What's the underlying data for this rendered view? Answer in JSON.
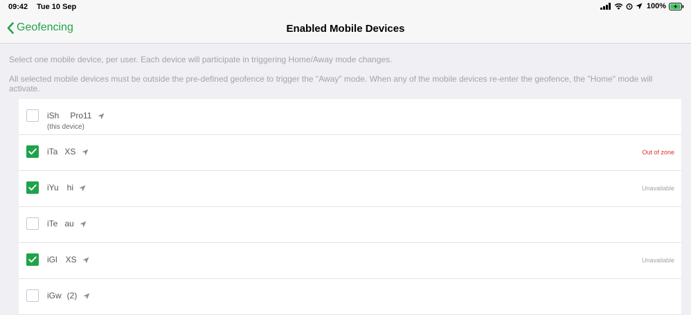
{
  "status_bar": {
    "time": "09:42",
    "date": "Tue 10 Sep",
    "battery": "100%"
  },
  "nav": {
    "back_label": "Geofencing",
    "title": "Enabled Mobile Devices"
  },
  "info": {
    "line1": "Select one mobile device, per user. Each device will participate in triggering Home/Away mode changes.",
    "line2": "All selected mobile devices must be outside the pre-defined geofence to trigger the \"Away\" mode. When any of the mobile devices re-enter the geofence, the \"Home\" mode will activate."
  },
  "devices": [
    {
      "name": "iSh        Pro11",
      "subtitle": "(this device)",
      "checked": false,
      "status": ""
    },
    {
      "name": "iTa     XS",
      "subtitle": "",
      "checked": true,
      "status": "Out of zone"
    },
    {
      "name": "iYu      hi",
      "subtitle": "",
      "checked": true,
      "status": "Unavailable"
    },
    {
      "name": "iTe     au",
      "subtitle": "",
      "checked": false,
      "status": ""
    },
    {
      "name": "iGl      XS",
      "subtitle": "",
      "checked": true,
      "status": "Unavailable"
    },
    {
      "name": "iGw    (2)",
      "subtitle": "",
      "checked": false,
      "status": ""
    }
  ],
  "colors": {
    "accent": "#1fa34a",
    "out_of_zone": "#e0302a",
    "muted": "#a3a3a8"
  }
}
